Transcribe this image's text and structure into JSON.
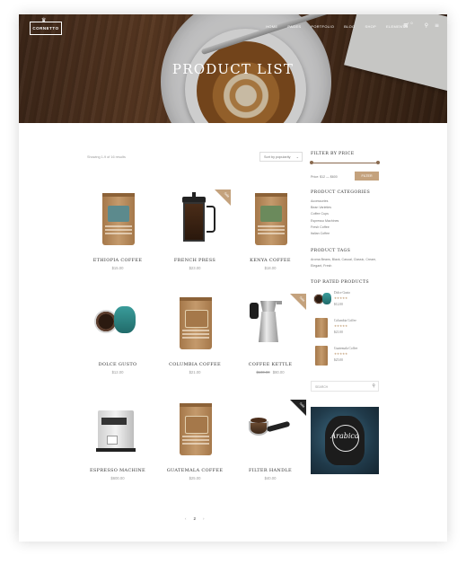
{
  "header": {
    "logo_text": "CORNETTO",
    "menu": [
      "HOME",
      "PAGES",
      "PORTFOLIO",
      "BLOG",
      "SHOP",
      "ELEMENTS"
    ],
    "cart_count": "0",
    "title": "PRODUCT LIST"
  },
  "toolbar": {
    "showing": "Showing 1-9 of 16 results",
    "sort_value": "Sort by popularity"
  },
  "products": [
    {
      "name": "ETHIOPIA COFFEE",
      "price": "$15.00",
      "sale": false
    },
    {
      "name": "FRENCH PRESS",
      "price": "$23.00",
      "sale": true,
      "badge": "Sale"
    },
    {
      "name": "KENYA COFFEE",
      "price": "$18.00",
      "sale": false
    },
    {
      "name": "DOLCE GUSTO",
      "price": "$12.00",
      "sale": false
    },
    {
      "name": "COLUMBIA COFFEE",
      "price": "$21.00",
      "sale": false
    },
    {
      "name": "COFFEE KETTLE",
      "old_price": "$100.00",
      "price": "$80.00",
      "sale": true,
      "badge": "Sale"
    },
    {
      "name": "ESPRESSO MACHINE",
      "price": "$600.00",
      "sale": false
    },
    {
      "name": "GUATEMALA COFFEE",
      "price": "$25.00",
      "sale": false
    },
    {
      "name": "FILTER HANDLE",
      "price": "$40.00",
      "sale": true,
      "badge": "Sale"
    }
  ],
  "pagination": {
    "prev": "‹",
    "current": "2",
    "next": "›"
  },
  "sidebar": {
    "filter_title": "FILTER BY PRICE",
    "price_range": "Price: $12 — $600",
    "filter_button": "FILTER",
    "categories_title": "PRODUCT CATEGORIES",
    "categories": [
      "Accessories",
      "Bean Varieties",
      "Coffee Cups",
      "Espresso Machines",
      "Fresh Coffee",
      "Italian Coffee"
    ],
    "tags_title": "PRODUCT TAGS",
    "tags": "Aroma Beans, Black, Casual, Classic, Cream, Elegant, Fresh",
    "top_title": "TOP RATED PRODUCTS",
    "top": [
      {
        "name": "Dolce Gusto",
        "stars": "★★★★★",
        "price": "$12.00"
      },
      {
        "name": "Columbia Coffee",
        "stars": "★★★★★",
        "price": "$21.00"
      },
      {
        "name": "Guatemala Coffee",
        "stars": "★★★★★",
        "price": "$25.00"
      }
    ],
    "search_placeholder": "SEARCH",
    "promo_text": "Arabica"
  },
  "colors": {
    "accent": "#c4a27d",
    "dark": "#222222"
  }
}
